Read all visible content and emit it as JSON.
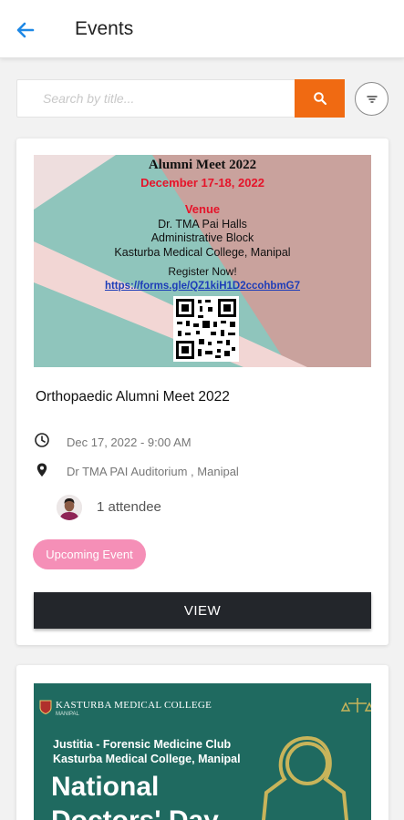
{
  "header": {
    "title": "Events",
    "back_icon": "arrow-left-icon"
  },
  "search": {
    "placeholder": "Search by title...",
    "value": "",
    "button_icon": "search-icon",
    "filter_icon": "filter-icon"
  },
  "colors": {
    "accent_orange": "#f06a12",
    "badge_pink": "#f58fb7",
    "view_button": "#23262b",
    "back_arrow_blue": "#1e88e5"
  },
  "events": [
    {
      "poster": {
        "title": "Alumni Meet 2022",
        "dates": "December 17-18, 2022",
        "venue_heading": "Venue",
        "venue_line1": "Dr. TMA Pai Halls",
        "venue_line2": "Administrative Block",
        "venue_line3": "Kasturba Medical College, Manipal",
        "register": "Register Now!",
        "url": "https://forms.gle/QZ1kiH1D2ccohbmG7"
      },
      "title": "Orthopaedic Alumni Meet 2022",
      "datetime": "Dec 17, 2022 - 9:00 AM",
      "location": "Dr TMA PAI Auditorium , Manipal",
      "attendees": "1 attendee",
      "status": "Upcoming Event",
      "view_label": "VIEW"
    },
    {
      "poster": {
        "college": "KASTURBA MEDICAL COLLEGE",
        "college_sub": "MANIPAL",
        "line1": "Justitia - Forensic Medicine Club",
        "line2": "Kasturba Medical College, Manipal",
        "big1": "National",
        "big2": "Doctors' Day"
      }
    }
  ]
}
